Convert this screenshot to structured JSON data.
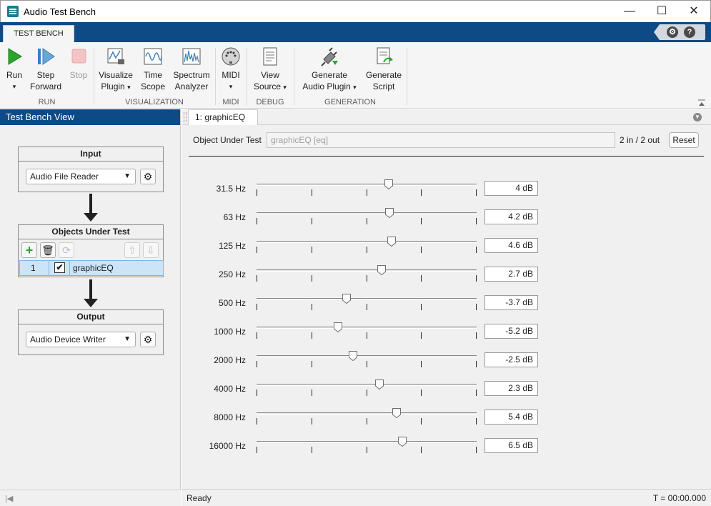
{
  "window": {
    "title": "Audio Test Bench",
    "minimize": "—",
    "maximize": "☐",
    "close": "✕"
  },
  "tabs": {
    "active": "TEST BENCH",
    "settings_icon": "gear-question-icon",
    "help": "?"
  },
  "toolstrip": {
    "run": {
      "line1": "Run",
      "dropdown": "▾"
    },
    "step": {
      "line1": "Step",
      "line2": "Forward"
    },
    "stop": {
      "line1": "Stop"
    },
    "group_run": "RUN",
    "visualize": {
      "line1": "Visualize",
      "line2": "Plugin"
    },
    "timescope": {
      "line1": "Time",
      "line2": "Scope"
    },
    "spectrum": {
      "line1": "Spectrum",
      "line2": "Analyzer"
    },
    "group_visualization": "VISUALIZATION",
    "midi": {
      "line1": "MIDI"
    },
    "group_midi": "MIDI",
    "viewsource": {
      "line1": "View",
      "line2": "Source"
    },
    "group_debug": "DEBUG",
    "generate_plugin": {
      "line1": "Generate",
      "line2": "Audio Plugin"
    },
    "generate_script": {
      "line1": "Generate",
      "line2": "Script"
    },
    "group_generation": "GENERATION"
  },
  "left_panel": {
    "header": "Test Bench View",
    "input": {
      "title": "Input",
      "selected": "Audio File Reader"
    },
    "objects": {
      "title": "Objects Under Test",
      "rows": [
        {
          "index": "1",
          "checked": "✔",
          "name": "graphicEQ"
        }
      ]
    },
    "output": {
      "title": "Output",
      "selected": "Audio Device Writer"
    }
  },
  "document": {
    "tab": "1: graphicEQ",
    "object_label": "Object Under Test",
    "object_value": "graphicEQ [eq]",
    "io": "2 in / 2 out",
    "reset": "Reset"
  },
  "bands": [
    {
      "label": "31.5 Hz",
      "value": "4 dB",
      "gain": 4
    },
    {
      "label": "63 Hz",
      "value": "4.2 dB",
      "gain": 4.2
    },
    {
      "label": "125 Hz",
      "value": "4.6 dB",
      "gain": 4.6
    },
    {
      "label": "250 Hz",
      "value": "2.7 dB",
      "gain": 2.7
    },
    {
      "label": "500 Hz",
      "value": "-3.7 dB",
      "gain": -3.7
    },
    {
      "label": "1000 Hz",
      "value": "-5.2 dB",
      "gain": -5.2
    },
    {
      "label": "2000 Hz",
      "value": "-2.5 dB",
      "gain": -2.5
    },
    {
      "label": "4000 Hz",
      "value": "2.3 dB",
      "gain": 2.3
    },
    {
      "label": "8000 Hz",
      "value": "5.4 dB",
      "gain": 5.4
    },
    {
      "label": "16000 Hz",
      "value": "6.5 dB",
      "gain": 6.5
    }
  ],
  "slider_range": [
    -20,
    20
  ],
  "status": {
    "left": "Ready",
    "right": "T = 00:00.000"
  },
  "colors": {
    "brand": "#0d4a86",
    "run_green": "#2aa52a",
    "selection": "#cce4f7"
  }
}
